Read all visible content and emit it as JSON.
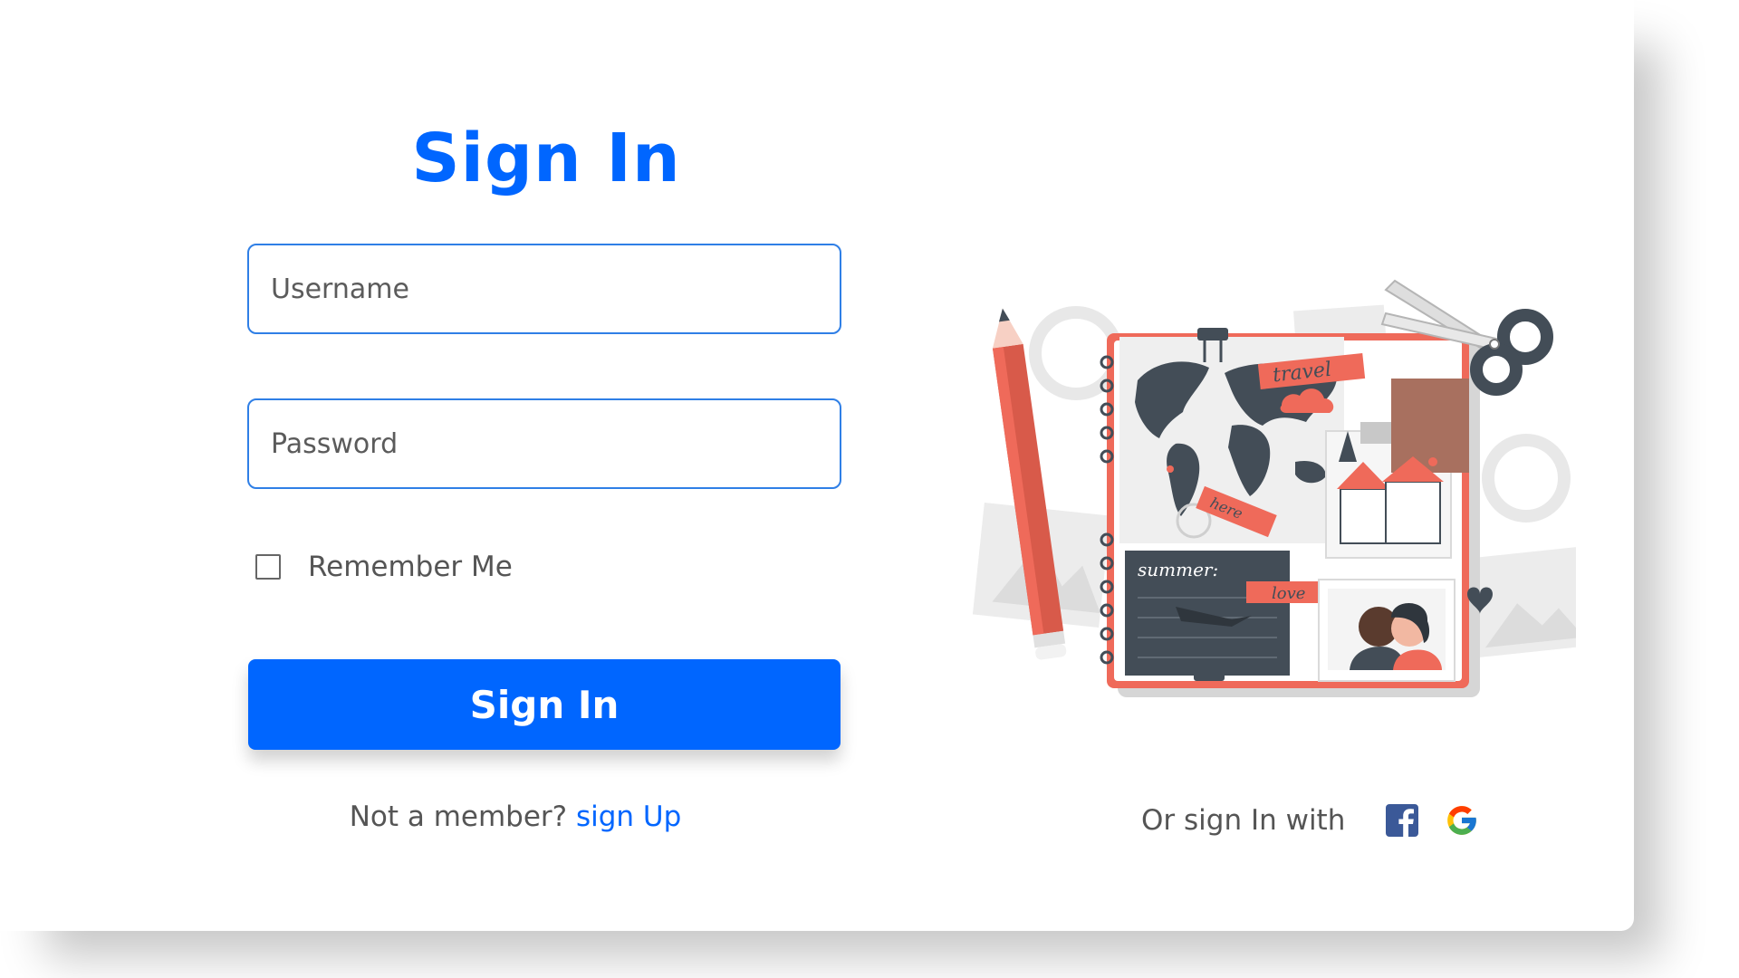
{
  "form": {
    "title": "Sign In",
    "username_placeholder": "Username",
    "password_placeholder": "Password",
    "remember_label": "Remember Me",
    "remember_checked": false,
    "submit_label": "Sign In"
  },
  "footer": {
    "member_text": "Not a member?",
    "signup_link": "sign Up",
    "social_text": "Or sign In with"
  },
  "illustration": {
    "labels": {
      "travel": "travel",
      "here": "here",
      "summer": "summer:",
      "love": "love"
    }
  },
  "social": {
    "icons": [
      "facebook-icon",
      "google-icon"
    ]
  },
  "colors": {
    "accent": "#0066ff",
    "field_border": "#2f7fe6",
    "text_muted": "#555555",
    "facebook": "#3b5998"
  }
}
